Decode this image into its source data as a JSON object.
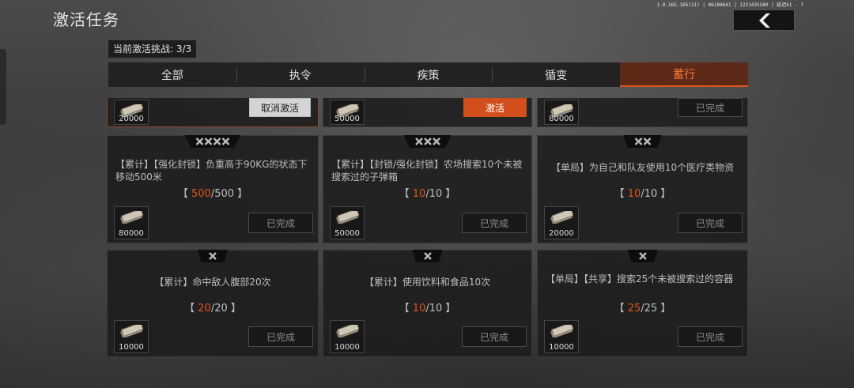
{
  "header": {
    "title": "激活任务",
    "debug": "1.0.165.165(21) | 06180641 | 1221435580 | 延迟41 - 7",
    "challenge_label": "当前激活挑战: 3/3"
  },
  "tabs": [
    {
      "label": "全部",
      "active": false
    },
    {
      "label": "执令",
      "active": false
    },
    {
      "label": "疾策",
      "active": false
    },
    {
      "label": "循变",
      "active": false
    },
    {
      "label": "蓄行",
      "active": true
    }
  ],
  "top_cards": [
    {
      "reward": "20000",
      "button": "取消激活",
      "button_type": "cancel"
    },
    {
      "reward": "50000",
      "button": "激活",
      "button_type": "activate"
    },
    {
      "reward": "80000",
      "button": "已完成",
      "button_type": "done"
    }
  ],
  "cards": [
    {
      "stars": 4,
      "desc": "【累计】【强化封锁】负重高于90KG的状态下移动500米",
      "cur": "500",
      "total": "/500",
      "reward": "80000",
      "button": "已完成"
    },
    {
      "stars": 3,
      "desc": "【累计】【封锁/强化封锁】农场搜索10个未被搜索过的子弹箱",
      "cur": "10",
      "total": "/10",
      "reward": "50000",
      "button": "已完成"
    },
    {
      "stars": 2,
      "desc": "【单局】为自己和队友使用10个医疗类物资",
      "cur": "10",
      "total": "/10",
      "reward": "20000",
      "button": "已完成"
    },
    {
      "stars": 1,
      "desc": "【累计】命中敌人腹部20次",
      "cur": "20",
      "total": "/20",
      "reward": "10000",
      "button": "已完成"
    },
    {
      "stars": 1,
      "desc": "【累计】使用饮料和食品10次",
      "cur": "10",
      "total": "/10",
      "reward": "10000",
      "button": "已完成"
    },
    {
      "stars": 1,
      "desc": "【单局】【共享】搜索25个未被搜索过的容器",
      "cur": "25",
      "total": "/25",
      "reward": "10000",
      "button": "已完成"
    }
  ],
  "colors": {
    "accent": "#e0541e",
    "active_tab_bg": "#5e2a18"
  }
}
